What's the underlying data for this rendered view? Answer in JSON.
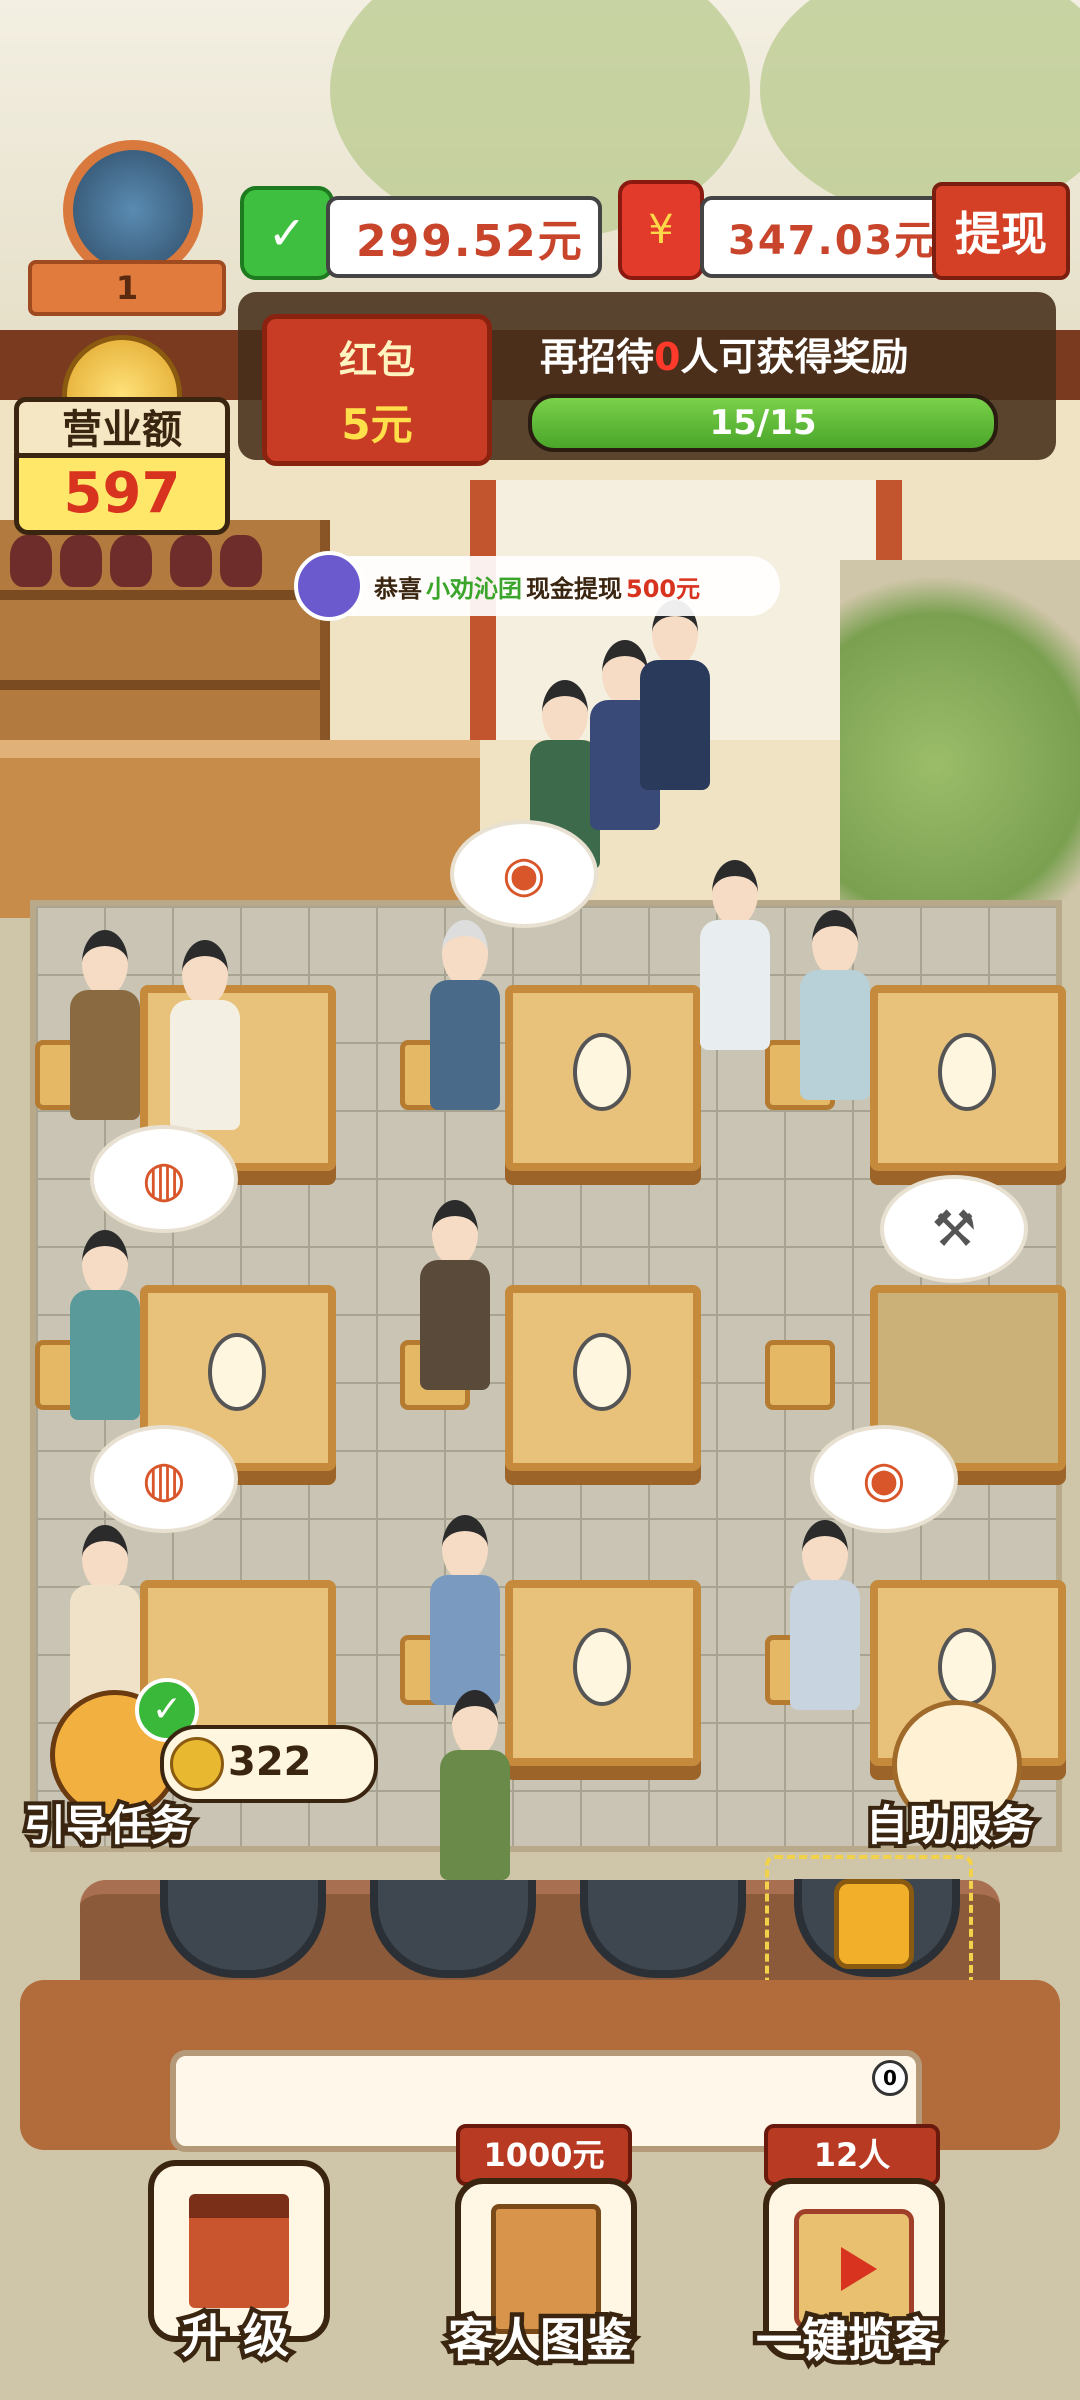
{
  "hud": {
    "level": "1",
    "wechat_balance": "299.52元",
    "redpacket_balance": "347.03元",
    "withdraw_label": "提现"
  },
  "task_panel": {
    "hongbao_title": "红包",
    "hongbao_amount": "5元",
    "task_prefix": "再招待",
    "task_count": "0",
    "task_suffix": "人可获得奖励",
    "progress_text": "15/15",
    "progress_fraction": 1.0
  },
  "revenue": {
    "label": "营业额",
    "value": "597"
  },
  "notice": {
    "prefix": "恭喜",
    "player_name": "小劝沁囝",
    "middle": "现金提现",
    "amount": "500元"
  },
  "side_buttons": {
    "guide_task_label": "引导任务",
    "guide_coins": "322",
    "self_service_label": "自助服务"
  },
  "message_bar": {
    "counter": "0"
  },
  "bottom_nav": {
    "upgrade_label": "升 级",
    "guest_book_label": "客人图鉴",
    "guest_book_tag": "1000元",
    "attract_label": "一键揽客",
    "attract_tag": "12人"
  },
  "icons": {
    "wechat": "wechat-icon",
    "redpacket": "redpacket-icon",
    "coin": "coin-icon",
    "lock": "lock-icon",
    "hammer": "hammer-icon",
    "dish": "dish-icon",
    "drum": "drum-icon"
  },
  "colors": {
    "accent_red": "#d44025",
    "progress_green": "#5ab83a",
    "revenue_yellow": "#ffe76a"
  }
}
